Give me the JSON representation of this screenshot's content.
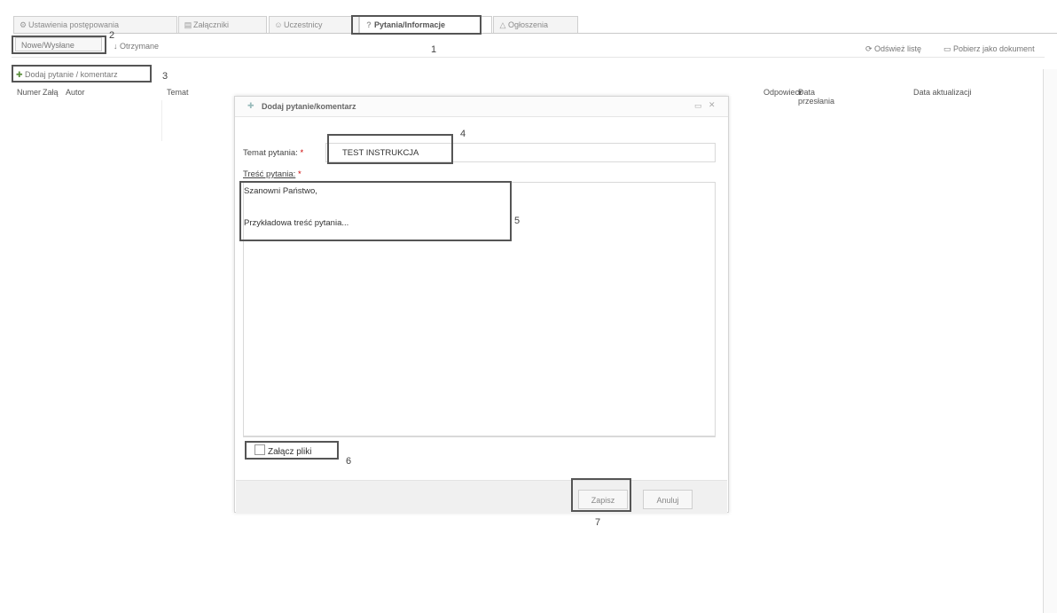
{
  "tabs": [
    {
      "label": "Ustawienia postępowania",
      "icon": "settings-icon"
    },
    {
      "label": "Załączniki",
      "icon": "attachment-icon"
    },
    {
      "label": "Uczestnicy",
      "icon": "users-icon"
    },
    {
      "label": "Pytania/Informacje",
      "icon": "question-icon"
    },
    {
      "label": "Ogłoszenia",
      "icon": "announcement-icon"
    }
  ],
  "subtabs": {
    "sent": "Nowe/Wysłane",
    "received": "Otrzymane"
  },
  "toolbar": {
    "refresh": "Odśwież listę",
    "download": "Pobierz jako dokument"
  },
  "add_button": "Dodaj pytanie / komentarz",
  "table": {
    "columns": [
      "Numer",
      "Załą",
      "Autor",
      "Temat",
      "Odpowiec",
      "Data przesłania",
      "Data aktualizacji"
    ]
  },
  "dialog": {
    "title": "Dodaj pytanie/komentarz",
    "subject_label": "Temat pytania:",
    "subject_value": "TEST INSTRUKCJA",
    "body_label": "Treść pytania:",
    "required_mark": "*",
    "body_line1": "Szanowni Państwo,",
    "body_line2": "Przykładowa treść pytania...",
    "attach_label": "Załącz pliki",
    "save": "Zapisz",
    "cancel": "Anuluj"
  },
  "annotations": [
    "1",
    "2",
    "3",
    "4",
    "5",
    "6",
    "7"
  ]
}
